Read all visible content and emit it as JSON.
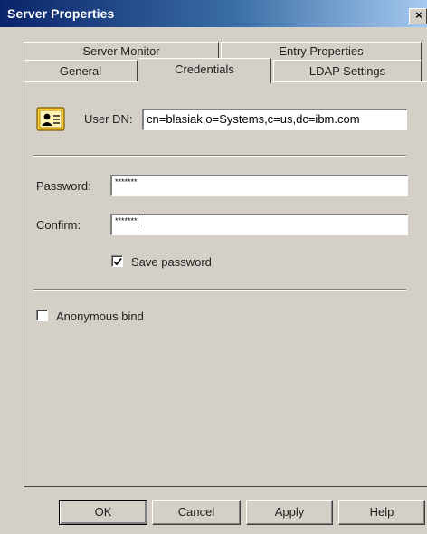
{
  "window": {
    "title": "Server Properties",
    "close_glyph": "×"
  },
  "tabs": {
    "server_monitor": "Server Monitor",
    "entry_properties": "Entry Properties",
    "general": "General",
    "credentials": "Credentials",
    "ldap_settings": "LDAP Settings",
    "active": "Credentials"
  },
  "credentials": {
    "user_dn_icon": "user-card-icon",
    "user_dn_label": "User DN:",
    "user_dn_value": "cn=blasiak,o=Systems,c=us,dc=ibm.com",
    "password_label": "Password:",
    "password_value": "*******",
    "confirm_label": "Confirm:",
    "confirm_value": "*******",
    "save_password_label": "Save password",
    "save_password_checked": true,
    "anonymous_bind_label": "Anonymous bind",
    "anonymous_bind_checked": false
  },
  "buttons": {
    "ok": "OK",
    "cancel": "Cancel",
    "apply": "Apply",
    "help": "Help"
  },
  "colors": {
    "dialog_face": "#d4d0c8",
    "title_bar_start": "#0a246a",
    "title_bar_end": "#a6caf0",
    "icon_yellow": "#ffcc33"
  }
}
